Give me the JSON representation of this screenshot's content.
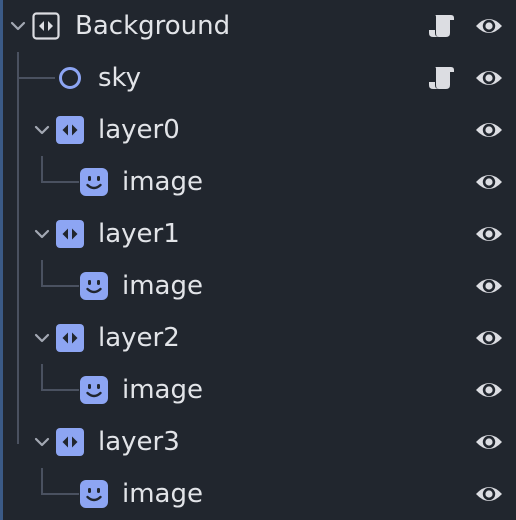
{
  "colors": {
    "background": "#21262e",
    "node_icon_blue": "#8da5f3",
    "text": "#e2e4e8",
    "guide_line": "#4a5160",
    "icon_light": "#dcdde2"
  },
  "scene_tree": {
    "root": {
      "label": "Background",
      "icon": "parallax-background-icon",
      "expanded": true,
      "has_script": true,
      "visible": true
    },
    "sky": {
      "label": "sky",
      "icon": "node-circle-icon",
      "has_script": true,
      "visible": true
    },
    "layers": [
      {
        "label": "layer0",
        "icon": "parallax-layer-icon",
        "expanded": true,
        "visible": true,
        "child": {
          "label": "image",
          "icon": "sprite-icon",
          "visible": true
        }
      },
      {
        "label": "layer1",
        "icon": "parallax-layer-icon",
        "expanded": true,
        "visible": true,
        "child": {
          "label": "image",
          "icon": "sprite-icon",
          "visible": true
        }
      },
      {
        "label": "layer2",
        "icon": "parallax-layer-icon",
        "expanded": true,
        "visible": true,
        "child": {
          "label": "image",
          "icon": "sprite-icon",
          "visible": true
        }
      },
      {
        "label": "layer3",
        "icon": "parallax-layer-icon",
        "expanded": true,
        "visible": true,
        "child": {
          "label": "image",
          "icon": "sprite-icon",
          "visible": true
        }
      }
    ]
  }
}
